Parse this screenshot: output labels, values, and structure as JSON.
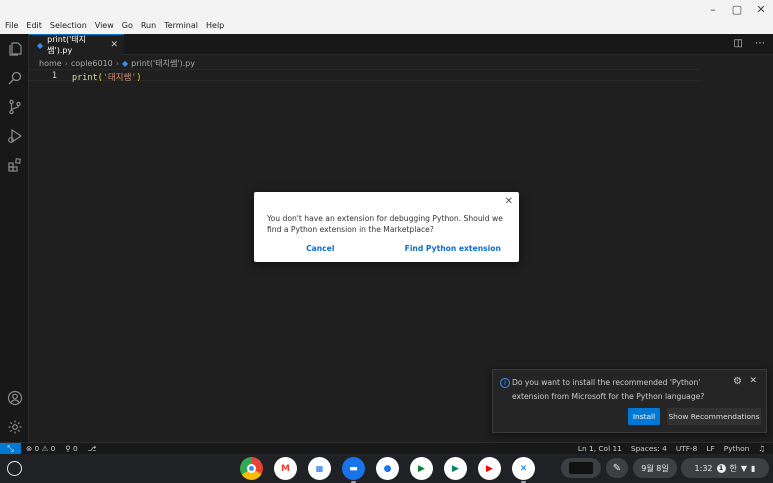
{
  "window": {
    "controls": {
      "minimize": "–",
      "maximize": "▢",
      "close": "✕"
    }
  },
  "menu": [
    "File",
    "Edit",
    "Selection",
    "View",
    "Go",
    "Run",
    "Terminal",
    "Help"
  ],
  "tab": {
    "label": "print('태지쌤').py",
    "close": "✕"
  },
  "tab_actions": {
    "split": "◫",
    "more": "⋯"
  },
  "breadcrumb": [
    "home",
    "cople6010",
    "print('태지쌤').py"
  ],
  "editor": {
    "line_number": "1",
    "code": {
      "fn": "print",
      "open": "(",
      "str": "'태지쌤'",
      "close": ")"
    }
  },
  "dialog": {
    "message": "You don't have an extension for debugging Python. Should we find a Python extension in the Marketplace?",
    "cancel": "Cancel",
    "confirm": "Find Python extension",
    "close": "✕"
  },
  "notification": {
    "message": "Do you want to install the recommended 'Python' extension from Microsoft for the Python language?",
    "install": "Install",
    "show": "Show Recommendations"
  },
  "status": {
    "remote": "⤡",
    "problems": "⊗ 0 ⚠ 0",
    "ports": "⚲ 0",
    "live": "⎇",
    "position": "Ln 1, Col 11",
    "spaces": "Spaces: 4",
    "encoding": "UTF-8",
    "eol": "LF",
    "language": "Python",
    "bell": "🔔"
  },
  "shelf": {
    "apps": [
      "chrome",
      "gmail",
      "calendar",
      "files",
      "chat",
      "meet",
      "play",
      "youtube",
      "vscode"
    ],
    "date": "9월 8일",
    "time": "1:32",
    "badge": "1",
    "ime": "한"
  },
  "colors": {
    "accent": "#0078d4",
    "editor_bg": "#1f1f1f",
    "shelf_bg": "#202124"
  }
}
